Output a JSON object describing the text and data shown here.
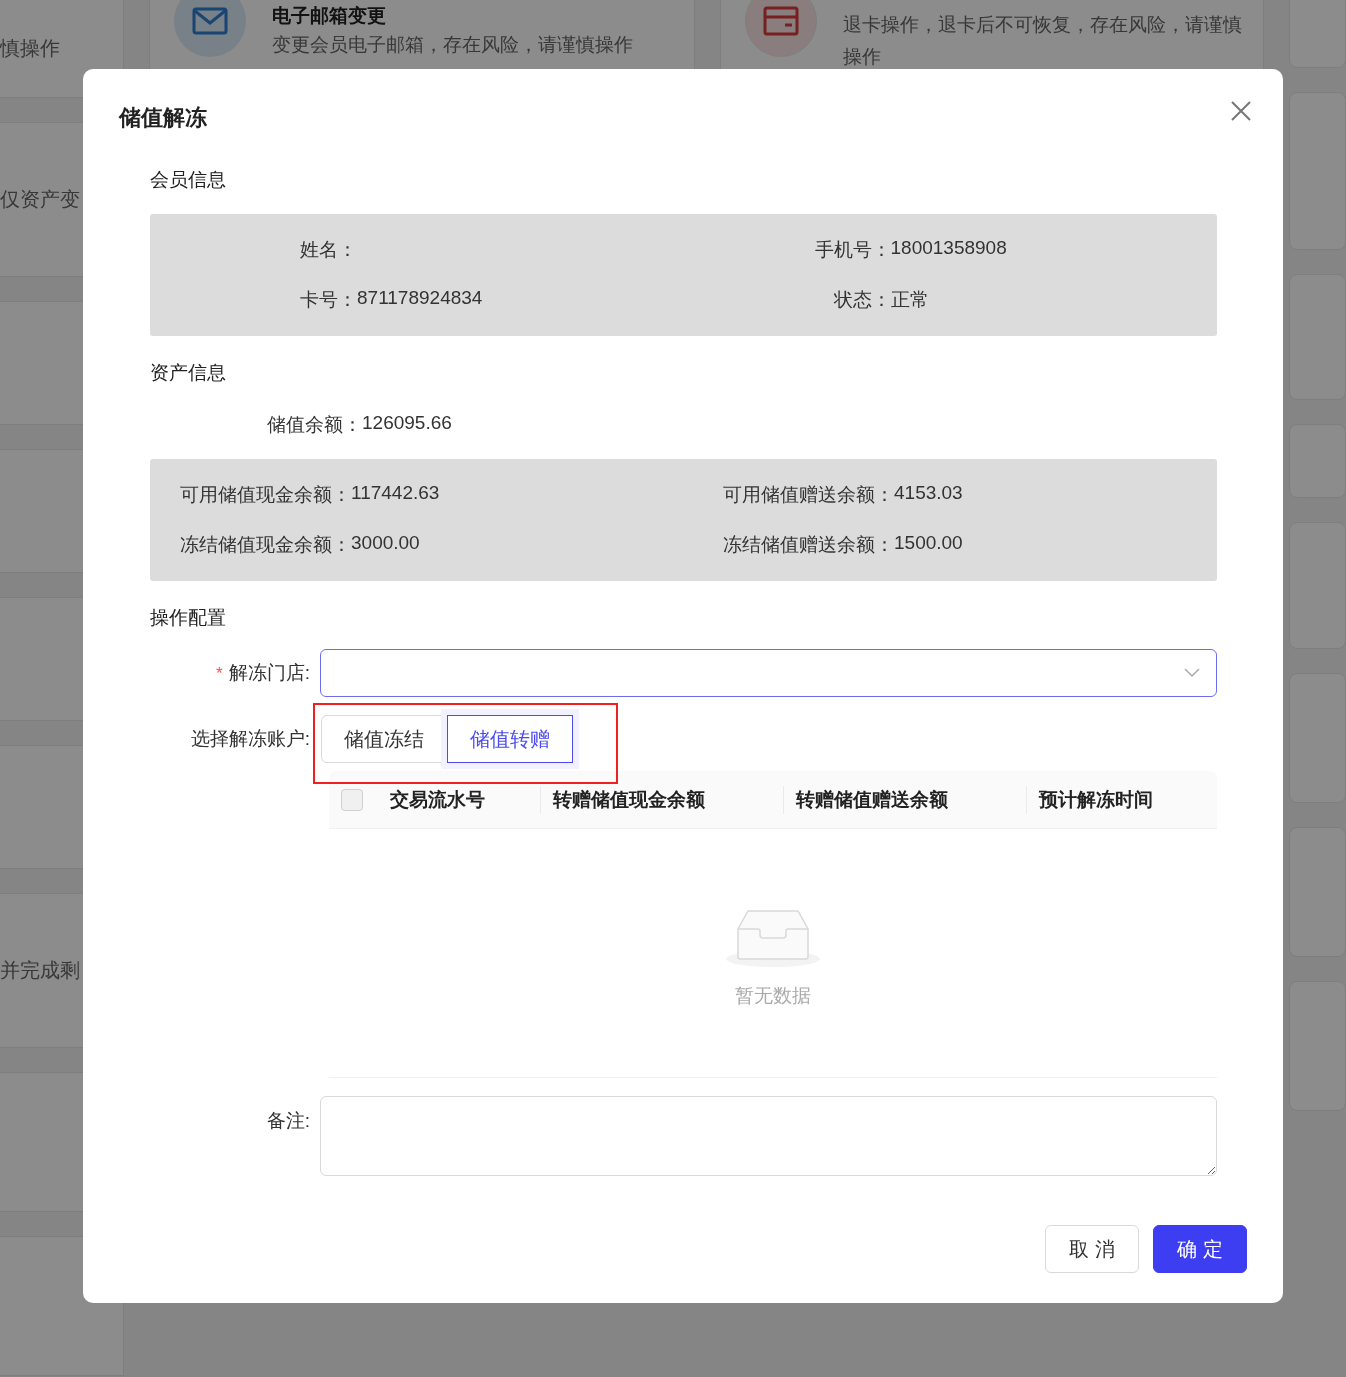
{
  "background": {
    "left_cards": [
      {
        "text": "慎操作"
      },
      {
        "text": "仅资产变"
      },
      {
        "text": "并完成剩"
      }
    ],
    "cards": [
      {
        "kind": "mail",
        "title": "电子邮箱变更",
        "description": "变更会员电子邮箱，存在风险，请谨慎操作"
      },
      {
        "kind": "card",
        "description": "退卡操作，退卡后不可恢复，存在风险，请谨慎操作"
      }
    ]
  },
  "dialog": {
    "title": "储值解冻",
    "member_info": {
      "heading": "会员信息",
      "fields": [
        {
          "label": "姓名："
        },
        {
          "label": "手机号：",
          "value": "18001358908"
        },
        {
          "label": "卡号：",
          "value": "871178924834"
        },
        {
          "label": "状态：",
          "value": "正常"
        }
      ]
    },
    "asset_info": {
      "heading": "资产信息",
      "balance": {
        "label": "储值余额：",
        "value": "126095.66"
      },
      "fields": [
        {
          "label": "可用储值现金余额：",
          "value": "117442.63"
        },
        {
          "label": "可用储值赠送余额：",
          "value": "4153.03"
        },
        {
          "label": "冻结储值现金余额：",
          "value": "3000.00"
        },
        {
          "label": "冻结储值赠送余额：",
          "value": "1500.00"
        }
      ]
    },
    "operation": {
      "heading": "操作配置",
      "store": {
        "label": "解冻门店:",
        "required_mark": "*"
      },
      "account": {
        "label": "选择解冻账户:",
        "highlighted": true,
        "options": [
          {
            "label": "储值冻结",
            "selected": false
          },
          {
            "label": "储值转赠",
            "selected": true
          }
        ]
      },
      "table": {
        "select_all": false,
        "columns": [
          "交易流水号",
          "转赠储值现金余额",
          "转赠储值赠送余额",
          "预计解冻时间"
        ],
        "empty_text": "暂无数据"
      },
      "remark": {
        "label": "备注:"
      }
    },
    "buttons": [
      {
        "label": "取 消",
        "kind": "default"
      },
      {
        "label": "确 定",
        "kind": "primary"
      }
    ]
  }
}
